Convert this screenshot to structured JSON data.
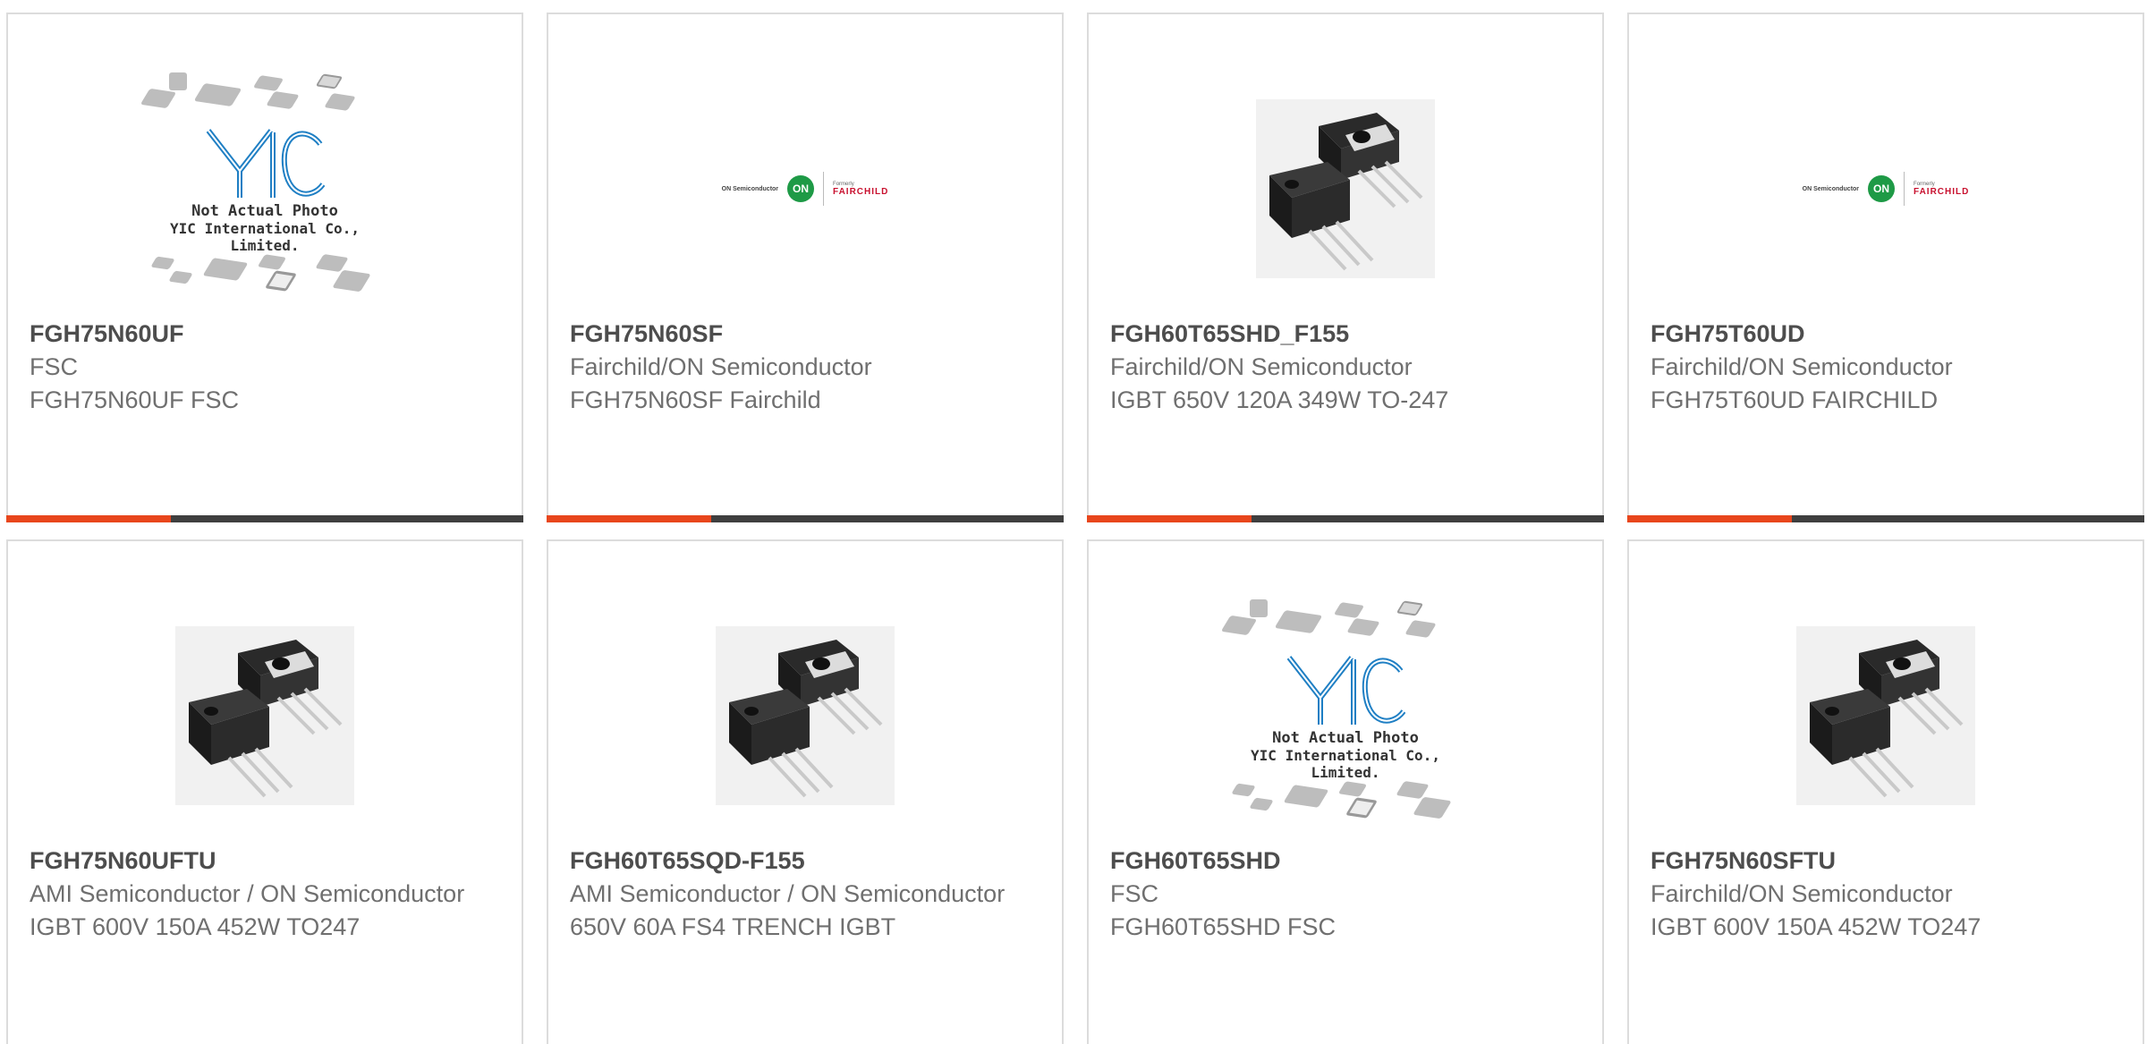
{
  "placeholder": {
    "line1": "Not Actual Photo",
    "line2": "YIC International Co., Limited."
  },
  "brand_logo": {
    "company": "ON Semiconductor",
    "mark": "ON",
    "formerly": "Formerly",
    "legacy": "FAIRCHILD"
  },
  "colors": {
    "accent": "#e8461c",
    "bar": "#3f3f3f"
  },
  "products": [
    {
      "part": "FGH75N60UF",
      "manufacturer": "FSC",
      "description": "FGH75N60UF FSC",
      "image": "yic-placeholder"
    },
    {
      "part": "FGH75N60SF",
      "manufacturer": "Fairchild/ON Semiconductor",
      "description": "FGH75N60SF Fairchild",
      "image": "on-fairchild-logo"
    },
    {
      "part": "FGH60T65SHD_F155",
      "manufacturer": "Fairchild/ON Semiconductor",
      "description": "IGBT 650V 120A 349W TO-247",
      "image": "to247-transistor"
    },
    {
      "part": "FGH75T60UD",
      "manufacturer": "Fairchild/ON Semiconductor",
      "description": "FGH75T60UD FAIRCHILD",
      "image": "on-fairchild-logo"
    },
    {
      "part": "FGH75N60UFTU",
      "manufacturer": "AMI Semiconductor / ON Semiconductor",
      "description": "IGBT 600V 150A 452W TO247",
      "image": "to247-transistor"
    },
    {
      "part": "FGH60T65SQD-F155",
      "manufacturer": "AMI Semiconductor / ON Semiconductor",
      "description": "650V 60A FS4 TRENCH IGBT",
      "image": "to247-transistor"
    },
    {
      "part": "FGH60T65SHD",
      "manufacturer": "FSC",
      "description": "FGH60T65SHD FSC",
      "image": "yic-placeholder"
    },
    {
      "part": "FGH75N60SFTU",
      "manufacturer": "Fairchild/ON Semiconductor",
      "description": "IGBT 600V 150A 452W TO247",
      "image": "to247-transistor"
    }
  ]
}
